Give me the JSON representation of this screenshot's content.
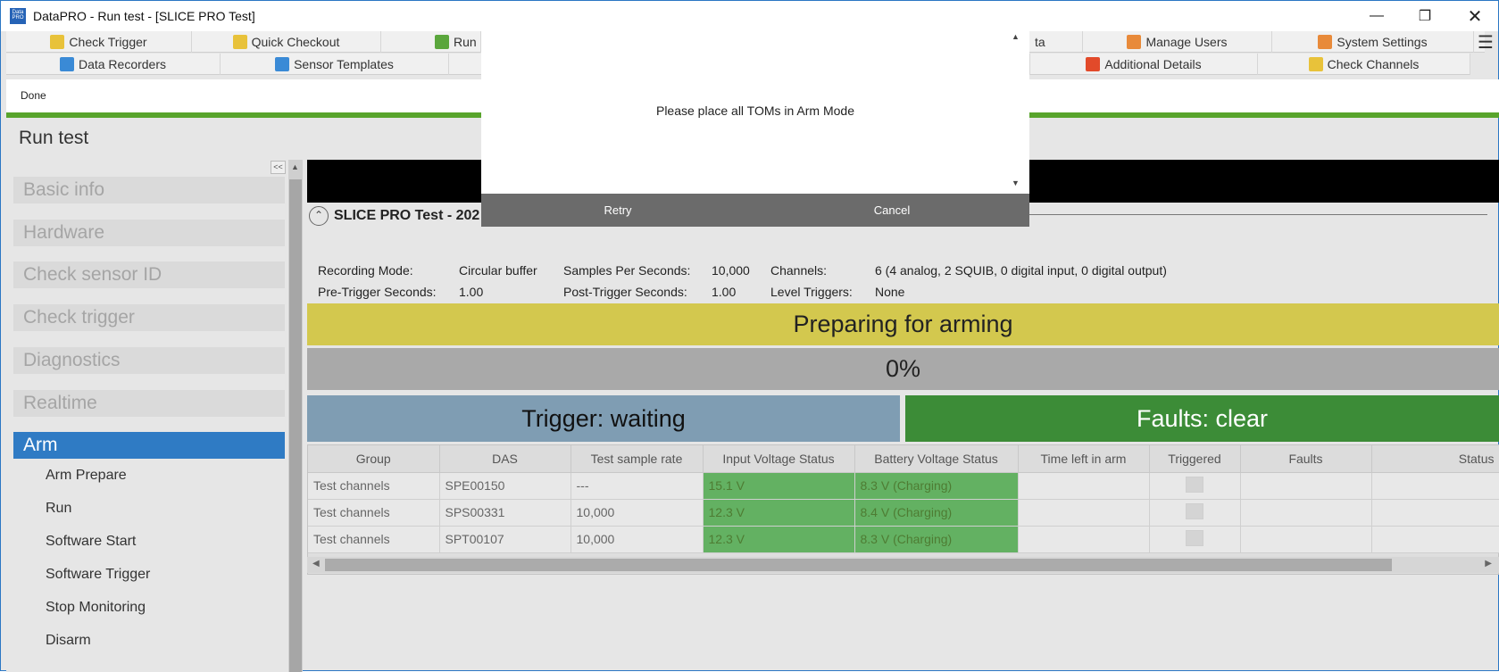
{
  "window": {
    "title": "DataPRO - Run test - [SLICE PRO Test]",
    "app_icon": "Data PRO"
  },
  "nav": {
    "row1": [
      {
        "label": "Check Trigger",
        "icon": "check-trigger-icon",
        "color": "#e8c23a"
      },
      {
        "label": "Quick Checkout",
        "icon": "quick-checkout-icon",
        "color": "#e8c23a"
      },
      {
        "label": "Run",
        "icon": "run-icon",
        "color": "#5aa63c"
      },
      {
        "label": "ta",
        "icon": "",
        "color": ""
      },
      {
        "label": "Manage Users",
        "icon": "manage-users-icon",
        "color": "#e88a3a"
      },
      {
        "label": "System Settings",
        "icon": "system-settings-icon",
        "color": "#e88a3a"
      }
    ],
    "row2": [
      {
        "label": "Data Recorders",
        "icon": "data-recorders-icon",
        "color": "#3a8ad6"
      },
      {
        "label": "Sensor Templates",
        "icon": "sensor-templates-icon",
        "color": "#3a8ad6"
      },
      {
        "label": "Additional Details",
        "icon": "additional-details-icon",
        "color": "#e24a2a"
      },
      {
        "label": "Check Channels",
        "icon": "check-channels-icon",
        "color": "#e8c23a"
      }
    ]
  },
  "status": {
    "text": "Done"
  },
  "page": {
    "title": "Run test"
  },
  "sidebar": {
    "collapse_label": "<<",
    "sections": [
      "Basic info",
      "Hardware",
      "Check sensor ID",
      "Check trigger",
      "Diagnostics",
      "Realtime",
      "Arm"
    ],
    "active_section": "Arm",
    "sub_items": [
      "Arm Prepare",
      "Run",
      "Software Start",
      "Software Trigger",
      "Stop Monitoring",
      "Disarm"
    ]
  },
  "test": {
    "name": "SLICE PRO Test - 202",
    "recording_mode_label": "Recording Mode:",
    "recording_mode": "Circular buffer",
    "sps_label": "Samples Per Seconds:",
    "sps": "10,000",
    "channels_label": "Channels:",
    "channels": "6 (4  analog, 2 SQUIB, 0 digital input, 0 digital output)",
    "pretrigger_label": "Pre-Trigger Seconds:",
    "pretrigger": "1.00",
    "posttrigger_label": "Post-Trigger Seconds:",
    "posttrigger": "1.00",
    "level_triggers_label": "Level Triggers:",
    "level_triggers": "None"
  },
  "bands": {
    "preparing": "Preparing for arming",
    "progress_text": "0%",
    "progress": 0,
    "trigger": "Trigger: waiting",
    "faults": "Faults: clear",
    "colors": {
      "preparing": "#d3c84e",
      "trigger": "#7f9db3",
      "faults": "#3c8c37"
    }
  },
  "table": {
    "headers": [
      "Group",
      "DAS",
      "Test sample rate",
      "Input Voltage Status",
      "Battery Voltage Status",
      "Time left in arm",
      "Triggered",
      "Faults",
      "Status"
    ],
    "rows": [
      [
        "Test channels",
        "SPE00150",
        "---",
        "15.1 V",
        "8.3 V (Charging)",
        "",
        "",
        "",
        ""
      ],
      [
        "Test channels",
        "SPS00331",
        "10,000",
        "12.3 V",
        "8.4 V (Charging)",
        "",
        "",
        "",
        ""
      ],
      [
        "Test channels",
        "SPT00107",
        "10,000",
        "12.3 V",
        "8.3 V (Charging)",
        "",
        "",
        "",
        ""
      ]
    ]
  },
  "dialog": {
    "message": "Please place all TOMs in Arm Mode",
    "retry_label": "Retry",
    "cancel_label": "Cancel"
  }
}
